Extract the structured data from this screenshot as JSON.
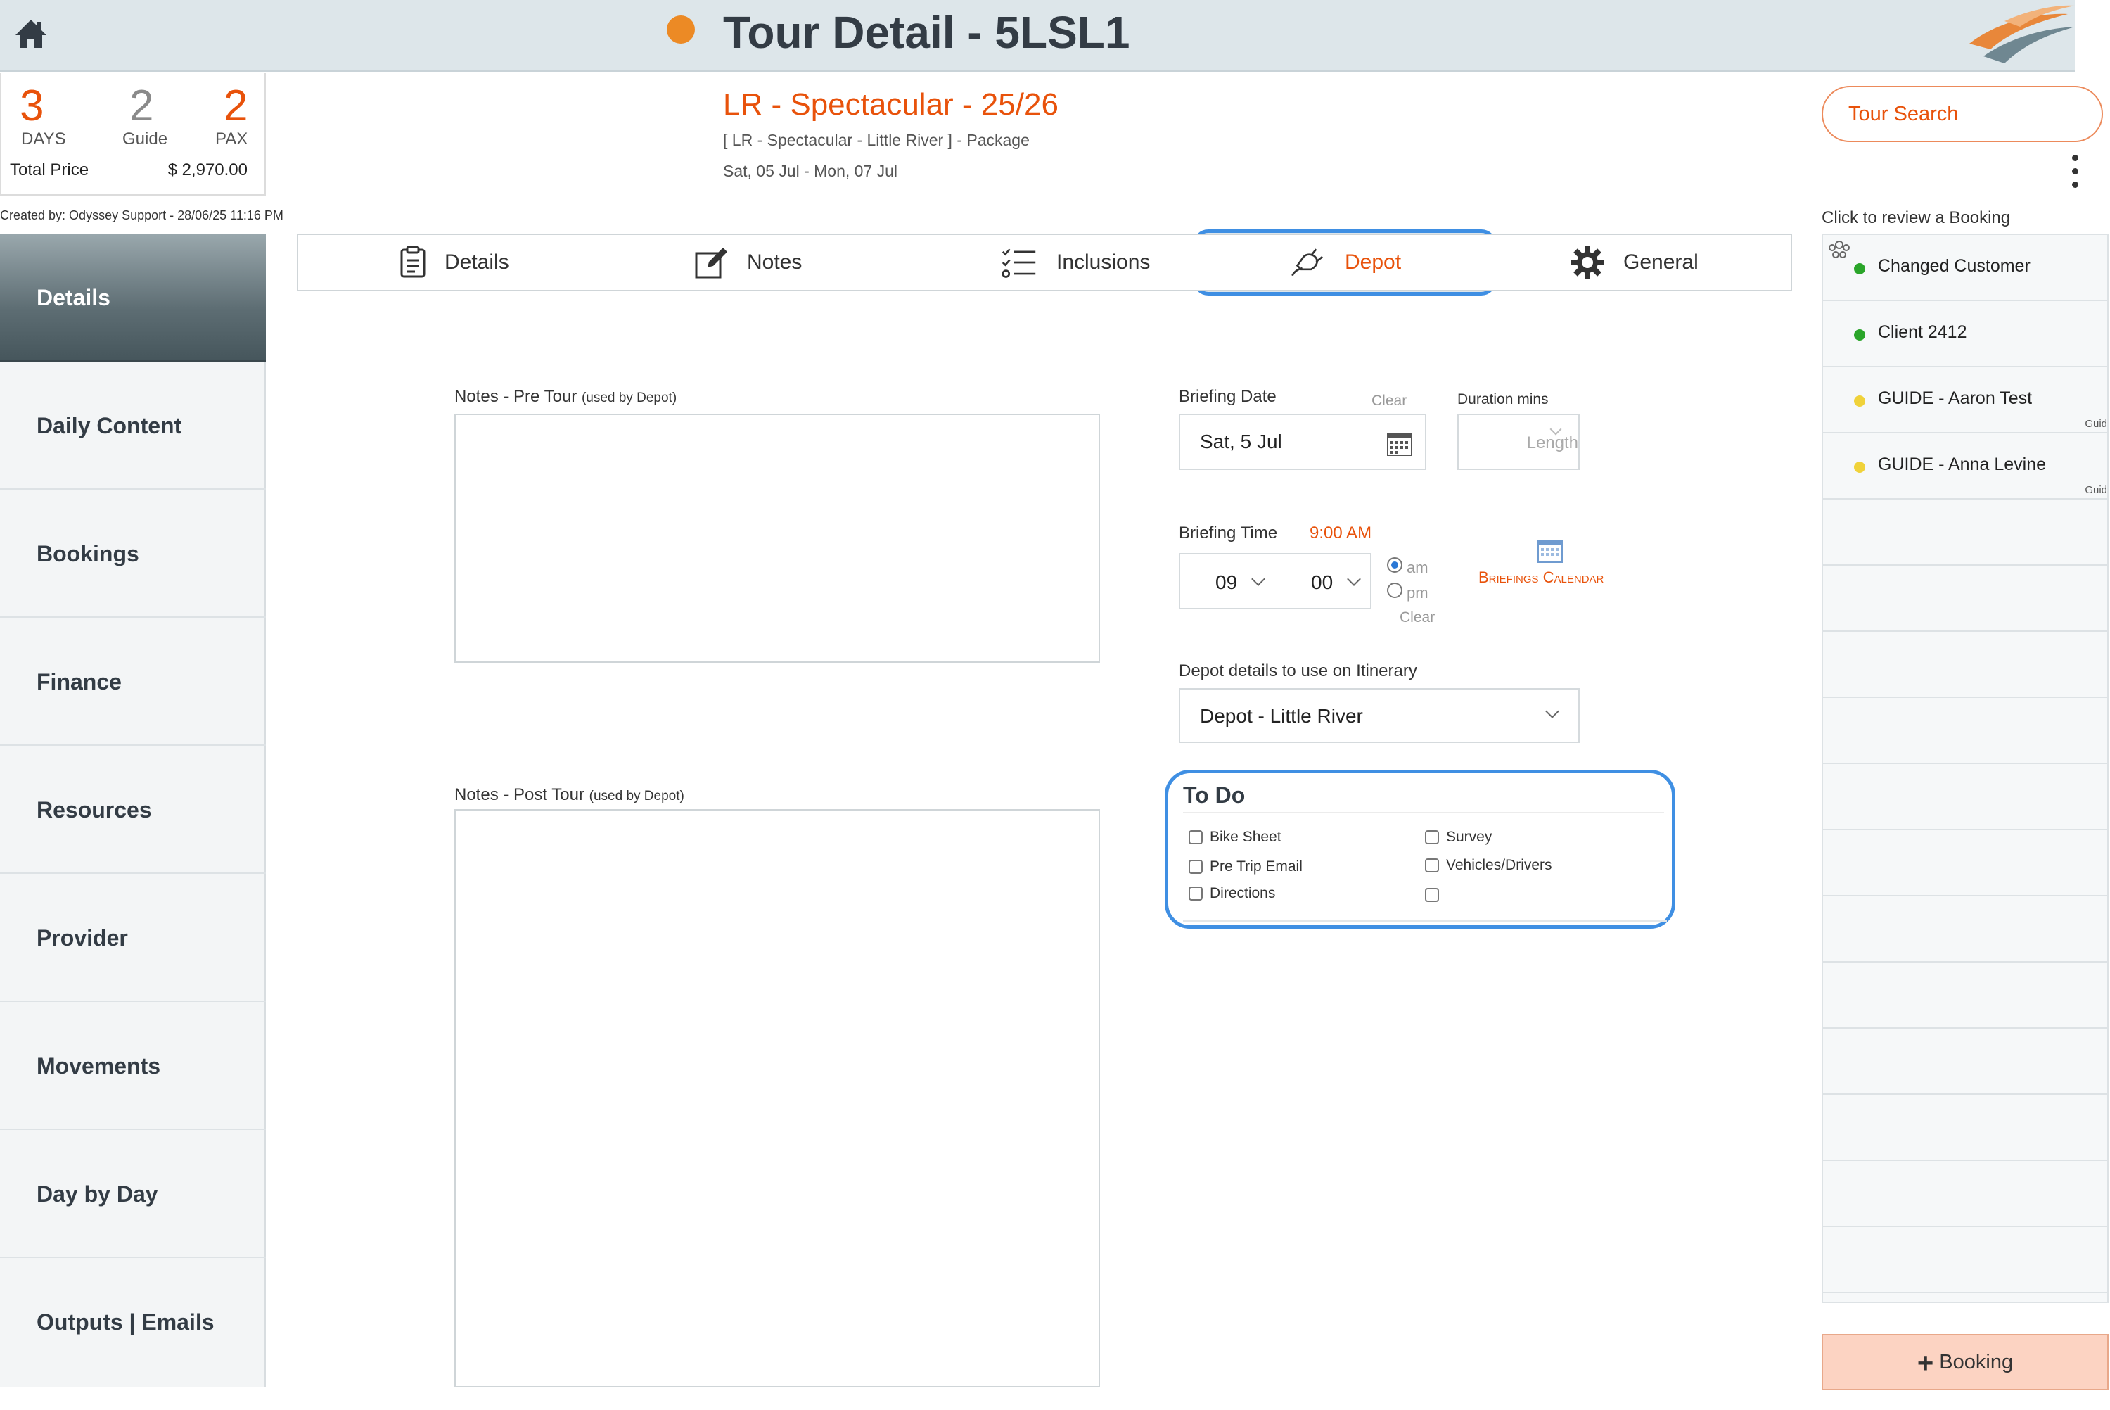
{
  "header": {
    "title": "Tour Detail - 5LSL1",
    "status_color": "#ec8a25"
  },
  "summary": {
    "days_value": "3",
    "days_label": "DAYS",
    "guide_value": "2",
    "guide_label": "Guide",
    "pax_value": "2",
    "pax_label": "PAX",
    "total_price_label": "Total Price",
    "total_price_value": "$ 2,970.00",
    "created_by": "Created by: Odyssey Support - 28/06/25 11:16 PM"
  },
  "tour": {
    "name": "LR - Spectacular - 25/26",
    "subtitle": "[ LR - Spectacular - Little River ] - Package",
    "dates": "Sat, 05 Jul  - Mon, 07 Jul"
  },
  "top_right": {
    "search_label": "Tour Search",
    "review_label": "Click to review a Booking"
  },
  "sidebar": {
    "items": [
      {
        "label": "Details"
      },
      {
        "label": "Daily Content"
      },
      {
        "label": "Bookings"
      },
      {
        "label": "Finance"
      },
      {
        "label": "Resources"
      },
      {
        "label": "Provider"
      },
      {
        "label": "Movements"
      },
      {
        "label": "Day by Day"
      },
      {
        "label": "Outputs | Emails"
      }
    ]
  },
  "tabs": [
    {
      "label": "Details",
      "icon": "clipboard-icon"
    },
    {
      "label": "Notes",
      "icon": "edit-icon"
    },
    {
      "label": "Inclusions",
      "icon": "checklist-icon"
    },
    {
      "label": "Depot",
      "icon": "plug-icon"
    },
    {
      "label": "General",
      "icon": "gear-icon"
    }
  ],
  "notes": {
    "pre_label": "Notes - Pre Tour",
    "pre_suffix": "(used by Depot)",
    "post_label": "Notes - Post Tour",
    "post_suffix": "(used by Depot)"
  },
  "briefing": {
    "date_label": "Briefing Date",
    "date_clear": "Clear",
    "date_value": "Sat, 5 Jul",
    "duration_label": "Duration mins",
    "duration_placeholder": "Length",
    "time_label": "Briefing Time",
    "time_value": "9:00 AM",
    "hour": "09",
    "minute": "00",
    "am_label": "am",
    "pm_label": "pm",
    "time_clear": "Clear",
    "calendar_label": "Briefings Calendar",
    "accent_color": "#e8520b"
  },
  "depot": {
    "label": "Depot details to use on Itinerary",
    "value": "Depot - Little River"
  },
  "todo": {
    "title": "To Do",
    "items": [
      {
        "label": "Bike Sheet"
      },
      {
        "label": "Pre Trip Email"
      },
      {
        "label": "Directions"
      },
      {
        "label": "Survey"
      },
      {
        "label": "Vehicles/Drivers"
      },
      {
        "label": ""
      }
    ]
  },
  "bookings": {
    "rows": [
      {
        "name": "Changed Customer",
        "dot": "#2aa52a",
        "tag": ""
      },
      {
        "name": "Client 2412",
        "dot": "#2aa52a",
        "tag": ""
      },
      {
        "name": "GUIDE - Aaron Test",
        "dot": "#f0d23a",
        "tag": "Guid"
      },
      {
        "name": "GUIDE - Anna Levine",
        "dot": "#f0d23a",
        "tag": "Guid"
      }
    ],
    "add_label": "Booking"
  }
}
